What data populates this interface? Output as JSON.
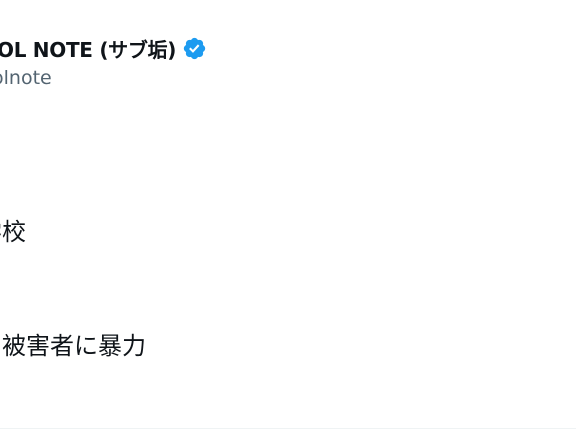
{
  "author": {
    "display_name": "OL NOTE (サブ垢)",
    "handle": "olnote",
    "verified": true,
    "badge_icon": "verified-badge-icon",
    "badge_color": "#1d9bf0"
  },
  "tweet": {
    "lines": [
      "学校",
      "の被害者に暴力",
      "）"
    ]
  },
  "colors": {
    "text_primary": "#0f1419",
    "text_secondary": "#536471",
    "background": "#ffffff"
  }
}
